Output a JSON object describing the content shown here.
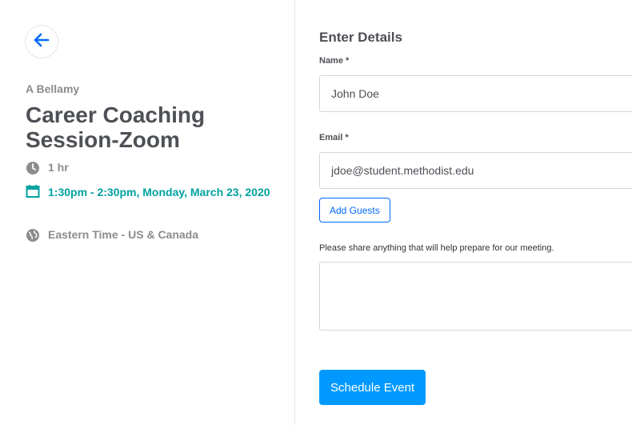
{
  "event": {
    "organizer": "A Bellamy",
    "title": "Career Coaching Session-Zoom",
    "duration": "1 hr",
    "datetime": "1:30pm - 2:30pm, Monday, March 23, 2020",
    "timezone": "Eastern Time - US & Canada"
  },
  "form": {
    "heading": "Enter Details",
    "name_label": "Name *",
    "name_value": "John Doe",
    "email_label": "Email *",
    "email_value": "jdoe@student.methodist.edu",
    "add_guests_label": "Add Guests",
    "notes_label": "Please share anything that will help prepare for our meeting.",
    "notes_value": "",
    "submit_label": "Schedule Event"
  },
  "icons": {
    "back": "arrow-left-icon",
    "duration": "clock-icon",
    "datetime": "calendar-icon",
    "timezone": "globe-icon"
  },
  "colors": {
    "accent": "#0069ff",
    "button": "#0099ff",
    "datetime": "#00a2a0",
    "muted": "#8c8c8c",
    "text": "#4d5055"
  }
}
